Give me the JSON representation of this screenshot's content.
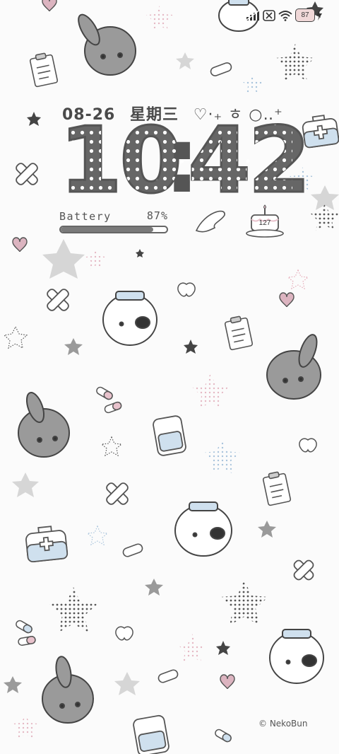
{
  "status_bar": {
    "battery_level": "87",
    "icons": [
      "signal-icon",
      "no-sim-icon",
      "wifi-icon",
      "battery-icon",
      "charging-icon"
    ]
  },
  "lockscreen": {
    "date": "08-26",
    "weekday": "星期三",
    "decoration": "♡·₊ ㅎ ○‥⁺",
    "time_hour": "10",
    "time_minute": "42",
    "time_separator": ":",
    "battery_label": "Battery",
    "battery_percent": "87%",
    "battery_level": 0.87,
    "cake_count": "127"
  },
  "watermark": "© NekoBun",
  "colors": {
    "digit_fill": "#666666",
    "accent_pink": "#e8c2cc",
    "accent_blue": "#cfe0ee",
    "background": "#fbfbfb"
  }
}
